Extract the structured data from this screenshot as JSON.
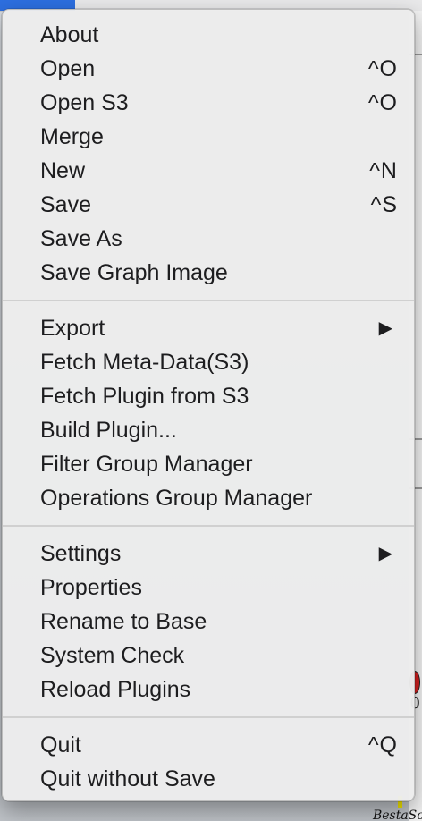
{
  "menu": {
    "groups": [
      {
        "items": [
          {
            "label": "About",
            "shortcut": ""
          },
          {
            "label": "Open",
            "shortcut": "^O"
          },
          {
            "label": "Open S3",
            "shortcut": "^O"
          },
          {
            "label": "Merge",
            "shortcut": ""
          },
          {
            "label": "New",
            "shortcut": "^N"
          },
          {
            "label": "Save",
            "shortcut": "^S"
          },
          {
            "label": "Save As",
            "shortcut": ""
          },
          {
            "label": "Save Graph Image",
            "shortcut": ""
          }
        ]
      },
      {
        "items": [
          {
            "label": "Export",
            "submenu": true
          },
          {
            "label": "Fetch Meta-Data(S3)"
          },
          {
            "label": "Fetch Plugin from S3"
          },
          {
            "label": "Build Plugin..."
          },
          {
            "label": "Filter Group Manager"
          },
          {
            "label": "Operations Group Manager"
          }
        ]
      },
      {
        "items": [
          {
            "label": "Settings",
            "submenu": true
          },
          {
            "label": "Properties"
          },
          {
            "label": "Rename to Base"
          },
          {
            "label": "System Check"
          },
          {
            "label": "Reload Plugins"
          }
        ]
      },
      {
        "items": [
          {
            "label": "Quit",
            "shortcut": "^Q"
          },
          {
            "label": "Quit without Save"
          }
        ]
      }
    ],
    "submenu_arrow_icon": "triangle-right-icon"
  },
  "background": {
    "right_edge_digit": "0",
    "right_edge_text": "BestaSolia",
    "accent_color": "#2d6fe0"
  }
}
